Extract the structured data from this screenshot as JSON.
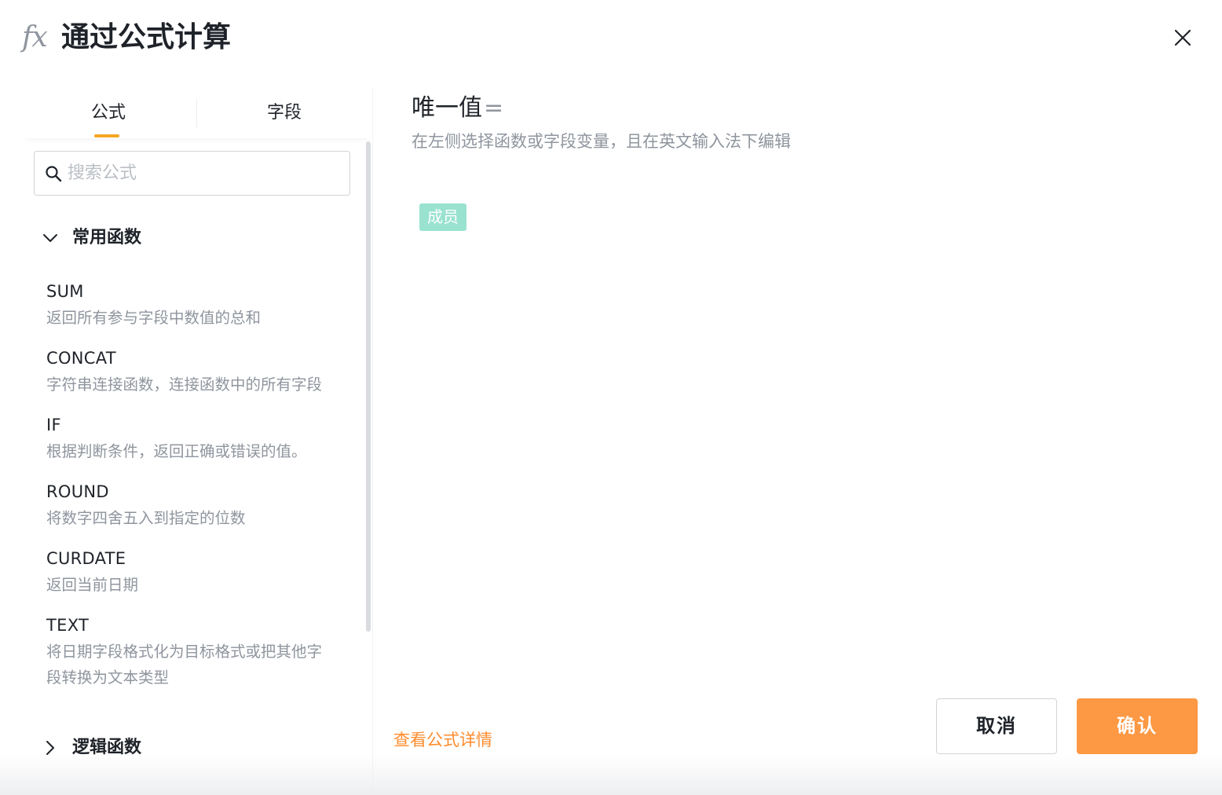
{
  "header": {
    "icon_text": "fx",
    "title": "通过公式计算",
    "close_icon": "close-icon"
  },
  "left_panel": {
    "tabs": [
      {
        "label": "公式",
        "active": true
      },
      {
        "label": "字段",
        "active": false
      }
    ],
    "search": {
      "placeholder": "搜索公式",
      "value": ""
    },
    "groups": [
      {
        "label": "常用函数",
        "expanded": true,
        "items": [
          {
            "name": "SUM",
            "desc": "返回所有参与字段中数值的总和"
          },
          {
            "name": "CONCAT",
            "desc": "字符串连接函数，连接函数中的所有字段"
          },
          {
            "name": "IF",
            "desc": "根据判断条件，返回正确或错误的值。"
          },
          {
            "name": "ROUND",
            "desc": "将数字四舍五入到指定的位数"
          },
          {
            "name": "CURDATE",
            "desc": "返回当前日期"
          },
          {
            "name": "TEXT",
            "desc": "将日期字段格式化为目标格式或把其他字段转换为文本类型"
          }
        ]
      },
      {
        "label": "逻辑函数",
        "expanded": false,
        "items": []
      }
    ]
  },
  "editor": {
    "field_name": "唯一值",
    "equals": "=",
    "hint": "在左侧选择函数或字段变量，且在英文输入法下编辑",
    "tokens": [
      {
        "label": "成员",
        "color": "#99e2cf"
      }
    ]
  },
  "footer": {
    "details_link": "查看公式详情",
    "cancel_label": "取消",
    "confirm_label": "确认"
  },
  "colors": {
    "accent": "#fd9844",
    "tab_indicator": "#f5a623",
    "link": "#ff8c2e",
    "token_bg": "#99e2cf",
    "muted_text": "#8f959e"
  }
}
